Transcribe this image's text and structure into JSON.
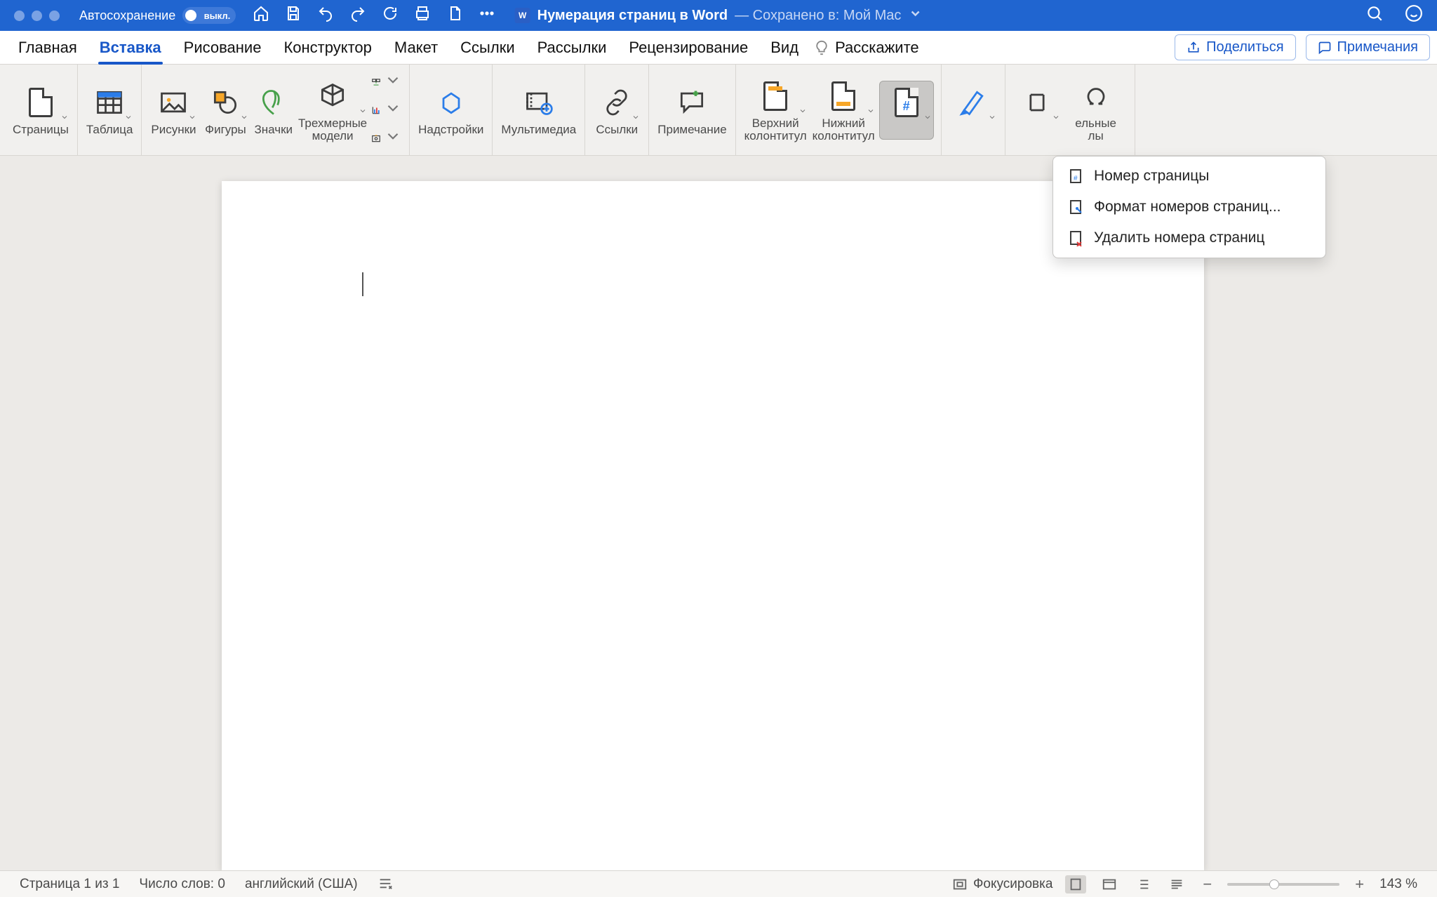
{
  "titlebar": {
    "autosave_label": "Автосохранение",
    "autosave_state": "выкл.",
    "doc_title": "Нумерация страниц в Word",
    "saved_in": "— Сохранено в: Мой Mac"
  },
  "tabs": [
    "Главная",
    "Вставка",
    "Рисование",
    "Конструктор",
    "Макет",
    "Ссылки",
    "Рассылки",
    "Рецензирование",
    "Вид"
  ],
  "active_tab_index": 1,
  "tellme": "Расскажите",
  "share_label": "Поделиться",
  "comments_label": "Примечания",
  "ribbon": {
    "pages": "Страницы",
    "table": "Таблица",
    "pictures": "Рисунки",
    "shapes": "Фигуры",
    "icons": "Значки",
    "models3d": "Трехмерные\nмодели",
    "addins": "Надстройки",
    "media": "Мультимедиа",
    "links": "Ссылки",
    "comment": "Примечание",
    "header": "Верхний\nколонтитул",
    "footer": "Нижний\nколонтитул",
    "pagenum": "Номер\nстраницы",
    "symbols_tail": "ельные\nлы"
  },
  "page_number_menu": {
    "insert": "Номер страницы",
    "format": "Формат номеров страниц...",
    "remove": "Удалить номера страниц"
  },
  "status": {
    "page": "Страница 1 из 1",
    "words": "Число слов: 0",
    "lang": "английский (США)",
    "focus": "Фокусировка",
    "zoom": "143 %"
  }
}
